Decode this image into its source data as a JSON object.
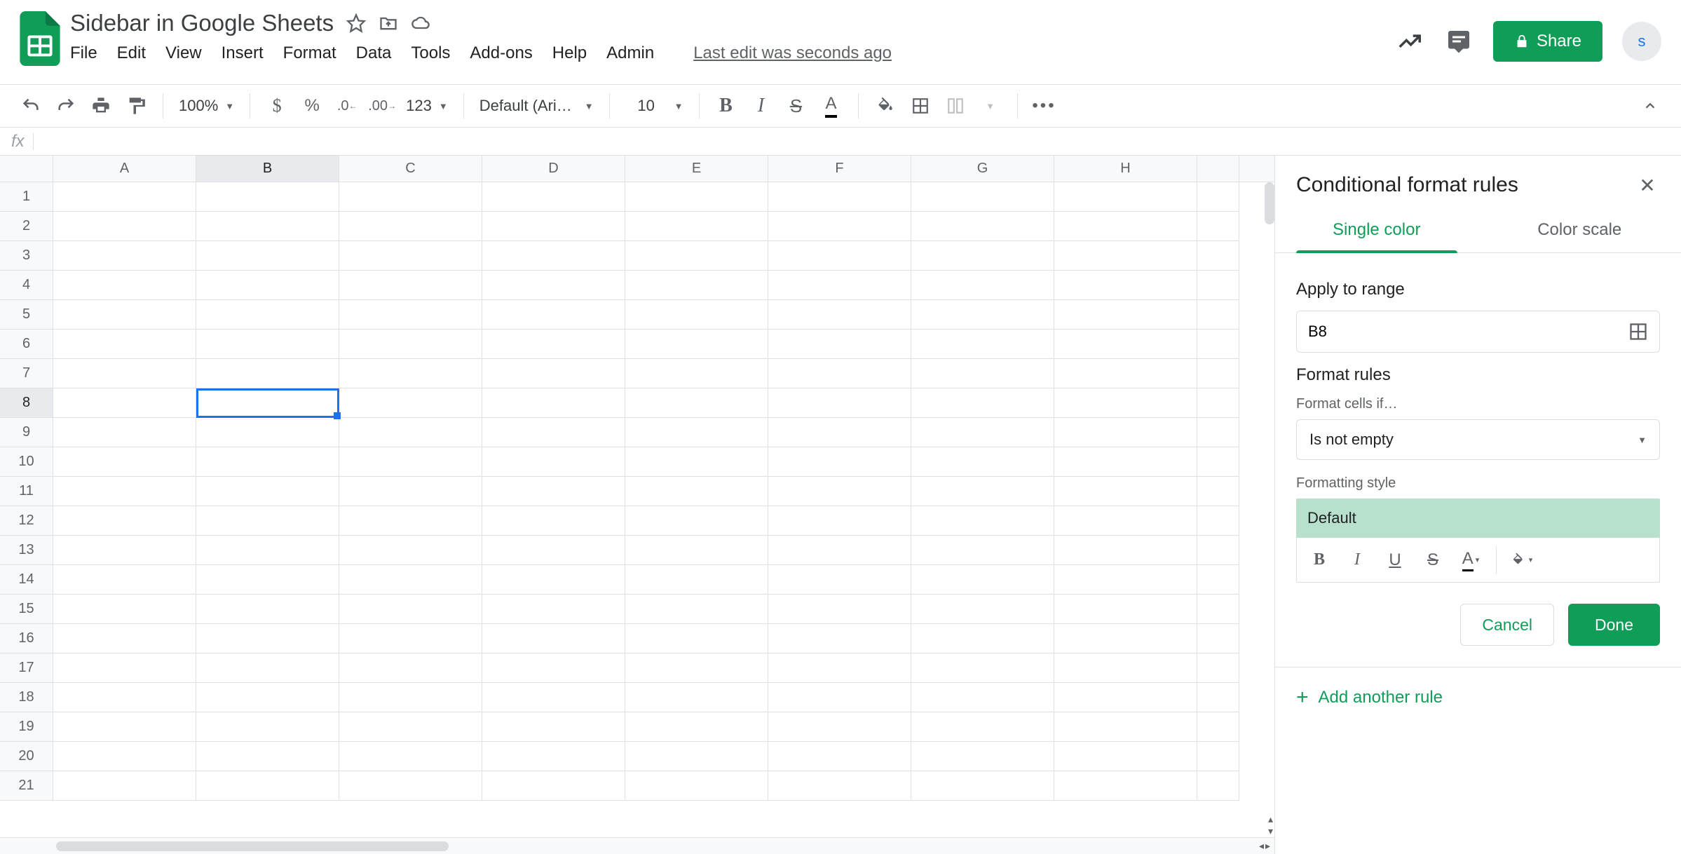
{
  "document": {
    "title": "Sidebar in Google Sheets",
    "last_edit": "Last edit was seconds ago"
  },
  "menus": [
    "File",
    "Edit",
    "View",
    "Insert",
    "Format",
    "Data",
    "Tools",
    "Add-ons",
    "Help",
    "Admin"
  ],
  "share": {
    "label": "Share",
    "avatar_initial": "s"
  },
  "toolbar": {
    "zoom": "100%",
    "font": "Default (Ari…",
    "size": "10",
    "format_number": "123"
  },
  "formula_bar": {
    "fx": "fx"
  },
  "grid": {
    "columns": [
      "A",
      "B",
      "C",
      "D",
      "E",
      "F",
      "G",
      "H"
    ],
    "rows": [
      1,
      2,
      3,
      4,
      5,
      6,
      7,
      8,
      9,
      10,
      11,
      12,
      13,
      14,
      15,
      16,
      17,
      18,
      19,
      20,
      21
    ],
    "active_cell": {
      "row": 8,
      "col": "B"
    }
  },
  "sidebar": {
    "title": "Conditional format rules",
    "tabs": {
      "single": "Single color",
      "scale": "Color scale"
    },
    "apply_range_label": "Apply to range",
    "range_value": "B8",
    "format_rules_label": "Format rules",
    "format_cells_if_label": "Format cells if…",
    "condition": "Is not empty",
    "formatting_style_label": "Formatting style",
    "style_preview": "Default",
    "cancel": "Cancel",
    "done": "Done",
    "add_rule": "Add another rule"
  }
}
